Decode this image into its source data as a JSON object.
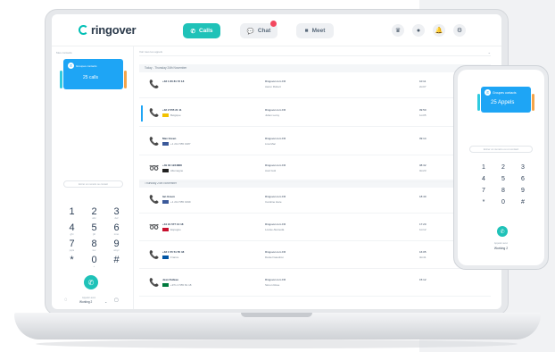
{
  "topbar": {
    "logo": "ringover",
    "tabs": {
      "calls": "Calls",
      "chat": "Chat",
      "meet": "Meet"
    },
    "colors": {
      "accent": "#1fc2b8",
      "badge": "#f2475e"
    },
    "icons": [
      "crown-icon",
      "user-icon",
      "bell-icon",
      "gear-icon"
    ]
  },
  "sidebar": {
    "label": "Mes contacts",
    "card": {
      "title": "Groupes contacts",
      "count": "25 calls"
    },
    "search_placeholder": "Entrer un numéro ou contact",
    "dialpad": [
      {
        "d": "1",
        "s": ""
      },
      {
        "d": "2",
        "s": "abc"
      },
      {
        "d": "3",
        "s": "def"
      },
      {
        "d": "4",
        "s": "ghi"
      },
      {
        "d": "5",
        "s": "jkl"
      },
      {
        "d": "6",
        "s": "mno"
      },
      {
        "d": "7",
        "s": "pqrs"
      },
      {
        "d": "8",
        "s": "tuv"
      },
      {
        "d": "9",
        "s": "wxyz"
      },
      {
        "d": "*",
        "s": ""
      },
      {
        "d": "0",
        "s": "+"
      },
      {
        "d": "#",
        "s": ""
      }
    ],
    "footer": {
      "label": "Appeler avec",
      "value": "Working 2"
    }
  },
  "main": {
    "filter": "Voir tous les appels",
    "groups": {
      "today": "Today - Thursday 24th November",
      "yesterday": "Thursday 24th November"
    },
    "rows": [
      {
        "icon": "📞",
        "color": "#1fc2b8",
        "name": "+33 1 80 81 72 18",
        "flag": "",
        "number": "",
        "line": "Ringover.com FR",
        "user": "Aaron Robert",
        "time": "10:11",
        "dur": "2m07"
      },
      {
        "icon": "📞",
        "color": "#1fc2b8",
        "name": "+32 2 555 21 11",
        "flag": "#f2c200",
        "number": "Belgique",
        "line": "Ringover.com FR",
        "user": "Julien Leroy",
        "time": "09:50",
        "dur": "1m05"
      },
      {
        "icon": "📞",
        "color": "#f2475e",
        "name": "Max Green",
        "flag": "#3c5a9a",
        "number": "+1 212 555 0187",
        "line": "Ringover.com FR",
        "user": "Lisa Mac",
        "time": "09:14",
        "dur": ""
      },
      {
        "icon": "➿",
        "color": "#f5a54a",
        "name": "+49 30 1234888",
        "flag": "#222222",
        "number": "Allemagne",
        "line": "Ringover.com FR",
        "user": "Axel Guti",
        "time": "08:32",
        "dur": "0m23"
      },
      {
        "icon": "📞",
        "color": "#f2475e",
        "name": "Ian Green",
        "flag": "#3c5a9a",
        "number": "+1 212 555 0199",
        "line": "Ringover.com FR",
        "user": "Caroline Hare",
        "time": "18:40",
        "dur": ""
      },
      {
        "icon": "➿",
        "color": "#f5a54a",
        "name": "+34 91 577 10 18",
        "flag": "#c8102e",
        "number": "Espagne",
        "line": "Ringover.com FR",
        "user": "Louise Alameda",
        "time": "17:20",
        "dur": "1m12"
      },
      {
        "icon": "📞",
        "color": "#1fc2b8",
        "name": "+33 1 55 51 55 48",
        "flag": "#0055a4",
        "number": "France",
        "line": "Ringover.com FR",
        "user": "Daniel Gaudron",
        "time": "16:05",
        "dur": "3m41"
      },
      {
        "icon": "📞",
        "color": "#f2475e",
        "name": "Jean Dufeau",
        "flag": "#007a3d",
        "number": "+971 4 555 81 18",
        "line": "Ringover.com FR",
        "user": "Simon Rose",
        "time": "15:12",
        "dur": ""
      }
    ]
  },
  "phone": {
    "card": {
      "title": "Groupes contacts",
      "count": "25 Appels"
    },
    "search_placeholder": "Entrer un numéro ou un contact",
    "dialpad": [
      "1",
      "2",
      "3",
      "4",
      "5",
      "6",
      "7",
      "8",
      "9",
      "*",
      "0",
      "#"
    ],
    "footer": {
      "label": "Appeler avec",
      "value": "Working 2"
    }
  }
}
